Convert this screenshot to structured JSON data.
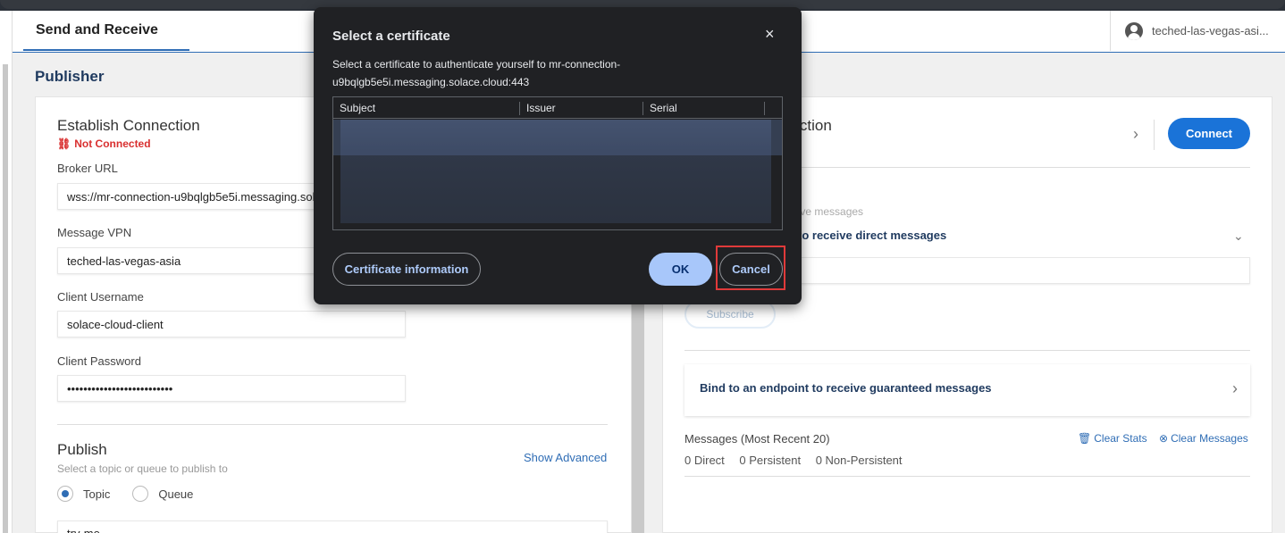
{
  "header": {
    "active_tab": "Send and Receive",
    "user_name": "teched-las-vegas-asi..."
  },
  "publisher": {
    "section_title": "Publisher",
    "establish": {
      "title": "Establish Connection",
      "status": "Not Connected",
      "status_color": "#d93030",
      "broker_url_label": "Broker URL",
      "broker_url_value": "wss://mr-connection-u9bqlgb5e5i.messaging.solace.cloud:443",
      "vpn_label": "Message VPN",
      "vpn_value": "teched-las-vegas-asia",
      "username_label": "Client Username",
      "username_value": "solace-cloud-client",
      "password_label": "Client Password",
      "password_value": "••••••••••••••••••••••••••"
    },
    "publish": {
      "title": "Publish",
      "subtitle": "Select a topic or queue to publish to",
      "show_advanced": "Show Advanced",
      "radio_topic": "Topic",
      "radio_queue": "Queue",
      "topic_value": "try-me"
    }
  },
  "subscriber": {
    "title_fragment": "nection",
    "connect_button": "Connect",
    "receive_hint": "eive messages",
    "direct_label": "to receive direct messages",
    "subscribe_button": "Subscribe",
    "bind_label": "Bind to an endpoint to receive guaranteed messages",
    "messages_title": "Messages  (Most Recent 20)",
    "clear_stats": "Clear Stats",
    "clear_messages": "Clear Messages",
    "stats": [
      "0 Direct",
      "0 Persistent",
      "0 Non-Persistent"
    ]
  },
  "dialog": {
    "title": "Select a certificate",
    "close_icon": "×",
    "description": "Select a certificate to authenticate yourself to mr-connection-u9bqlgb5e5i.messaging.solace.cloud:443",
    "columns": [
      "Subject",
      "Issuer",
      "Serial"
    ],
    "cert_info_button": "Certificate information",
    "ok_button": "OK",
    "cancel_button": "Cancel",
    "highlight_color": "#e03a3a"
  },
  "colors": {
    "accent": "#2f6db5",
    "primary_button": "#1a73d8",
    "dialog_bg": "#202124"
  }
}
